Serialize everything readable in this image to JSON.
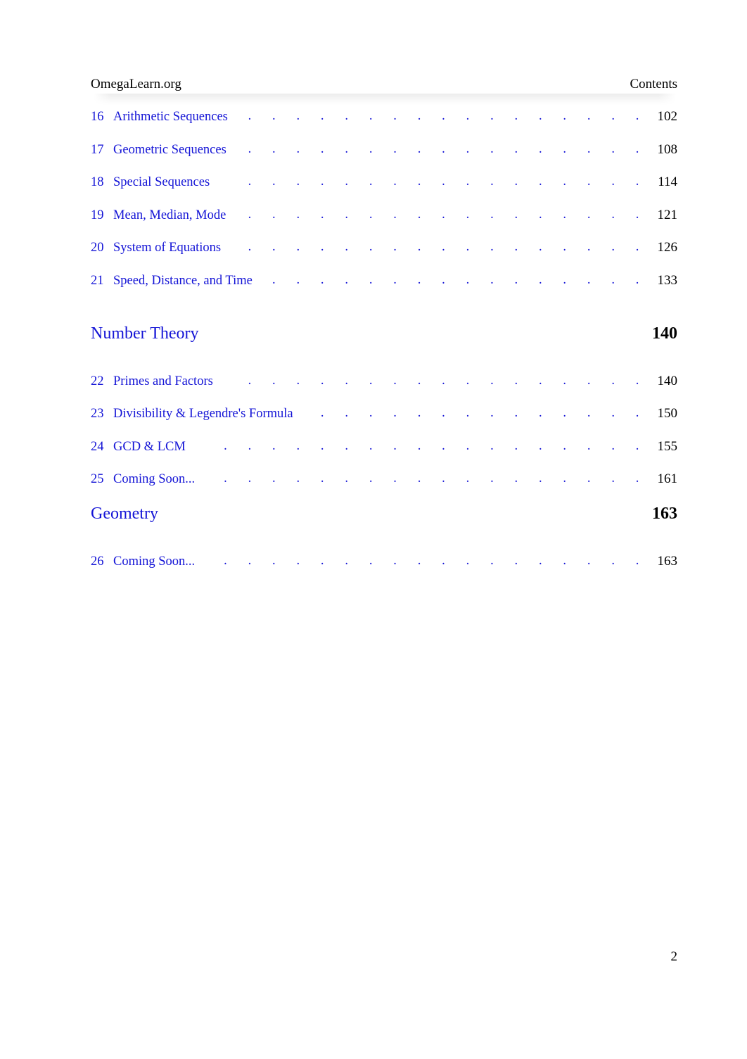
{
  "document": {
    "header": {
      "left": "OmegaLearn.org",
      "right": "Contents"
    },
    "folio": "2",
    "link_color": "#1414d6",
    "text_color": "#000000"
  },
  "toc": {
    "entries": [
      {
        "kind": "chapter",
        "number": "16",
        "title": "Arithmetic Sequences",
        "page": "102"
      },
      {
        "kind": "chapter",
        "number": "17",
        "title": "Geometric Sequences",
        "page": "108"
      },
      {
        "kind": "chapter",
        "number": "18",
        "title": "Special Sequences",
        "page": "114"
      },
      {
        "kind": "chapter",
        "number": "19",
        "title": "Mean, Median, Mode",
        "page": "121"
      },
      {
        "kind": "chapter",
        "number": "20",
        "title": "System of Equations",
        "page": "126"
      },
      {
        "kind": "chapter",
        "number": "21",
        "title": "Speed, Distance, and Time",
        "page": "133"
      },
      {
        "kind": "part",
        "number": "",
        "title": "Number Theory",
        "page": "140"
      },
      {
        "kind": "chapter",
        "number": "22",
        "title": "Primes and Factors",
        "page": "140"
      },
      {
        "kind": "chapter",
        "number": "23",
        "title": "Divisibility & Legendre's Formula",
        "page": "150"
      },
      {
        "kind": "chapter",
        "number": "24",
        "title": "GCD & LCM",
        "page": "155"
      },
      {
        "kind": "chapter",
        "number": "25",
        "title": "Coming Soon...",
        "page": "161"
      },
      {
        "kind": "part",
        "number": "",
        "title": "Geometry",
        "page": "163"
      },
      {
        "kind": "chapter",
        "number": "26",
        "title": "Coming Soon...",
        "page": "163"
      }
    ],
    "leader_dots": ". . . . . . . . . . . . . . . . . . . . . . . . . . . . . . . . . . . . . . . . . . . . . . . . ."
  }
}
